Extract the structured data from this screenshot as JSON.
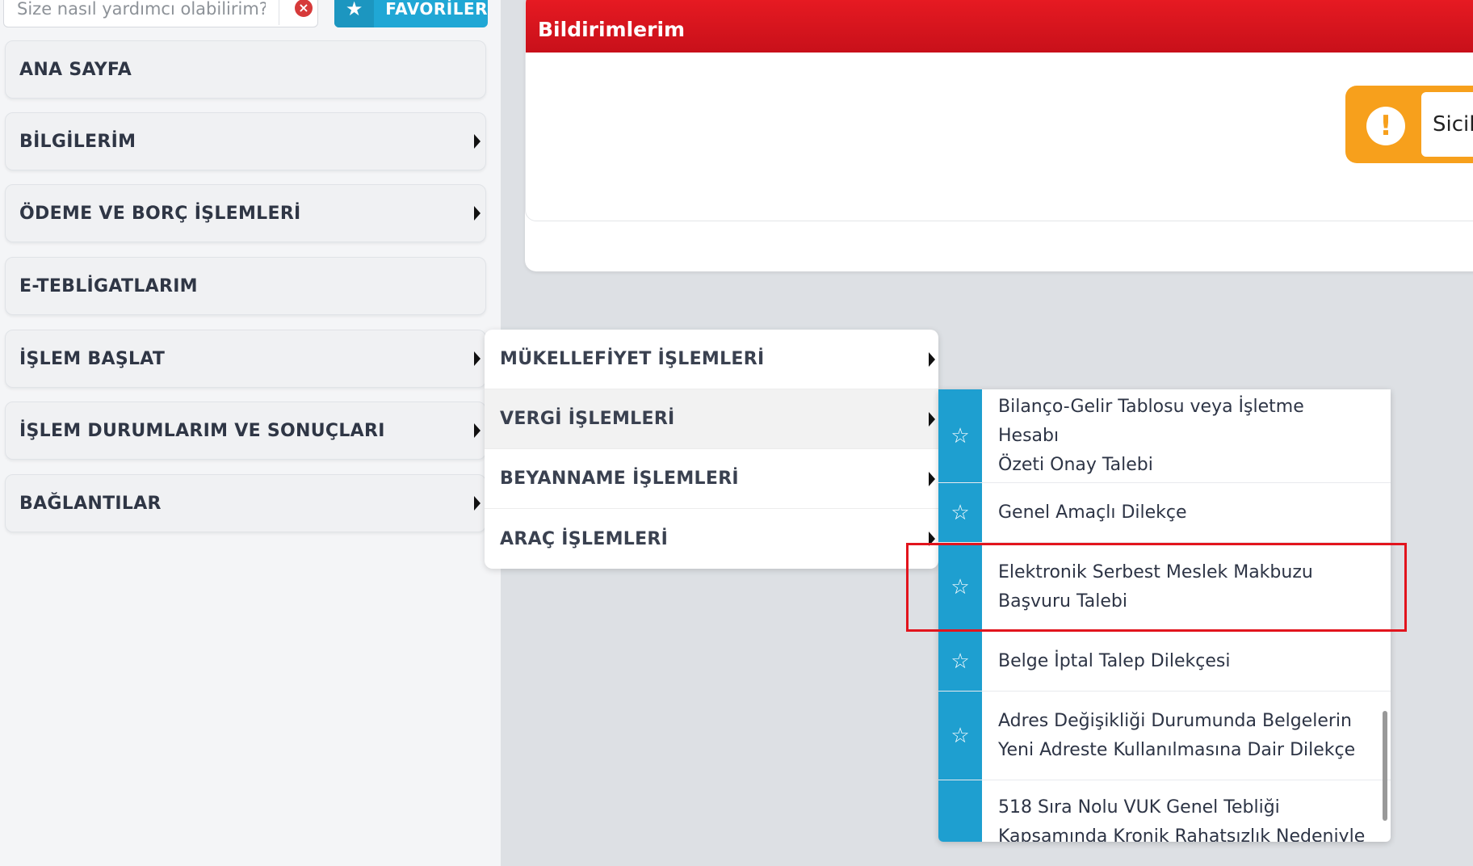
{
  "search": {
    "placeholder": "Size nasıl yardımcı olabilirim?"
  },
  "favorites": {
    "label": "FAVORİLER"
  },
  "sidebar": {
    "items": [
      {
        "label": "ANA SAYFA"
      },
      {
        "label": "BİLGİLERİM"
      },
      {
        "label": "ÖDEME VE BORÇ İŞLEMLERİ"
      },
      {
        "label": "E-TEBLİGATLARIM"
      },
      {
        "label": "İŞLEM BAŞLAT"
      },
      {
        "label": "İŞLEM DURUMLARIM VE SONUÇLARI"
      },
      {
        "label": "BAĞLANTILAR"
      }
    ]
  },
  "notifications": {
    "title": "Bildirimlerim",
    "alert_text": "Sicil"
  },
  "submenu": {
    "items": [
      {
        "label": "MÜKELLEFİYET İŞLEMLERİ"
      },
      {
        "label": "VERGİ İŞLEMLERİ"
      },
      {
        "label": "BEYANNAME İŞLEMLERİ"
      },
      {
        "label": "ARAÇ İŞLEMLERİ"
      }
    ]
  },
  "vergi_menu": {
    "items": [
      {
        "line1": "Bilanço-Gelir Tablosu veya İşletme Hesabı",
        "line2": "Özeti Onay Talebi"
      },
      {
        "line1": "Genel Amaçlı Dilekçe",
        "line2": ""
      },
      {
        "line1": "Elektronik Serbest Meslek Makbuzu",
        "line2": "Başvuru Talebi"
      },
      {
        "line1": "Belge İptal Talep Dilekçesi",
        "line2": ""
      },
      {
        "line1": "Adres Değişikliği Durumunda Belgelerin",
        "line2": "Yeni Adreste Kullanılmasına Dair Dilekçe"
      },
      {
        "line1": "518 Sıra Nolu VUK Genel Tebliği",
        "line2": "Kapsamında Kronik Rahatsızlık Nedeniyle"
      }
    ]
  },
  "colors": {
    "header_red": "#e2141d",
    "accent_blue": "#1e9fd0",
    "alert_orange": "#f7a01c"
  }
}
